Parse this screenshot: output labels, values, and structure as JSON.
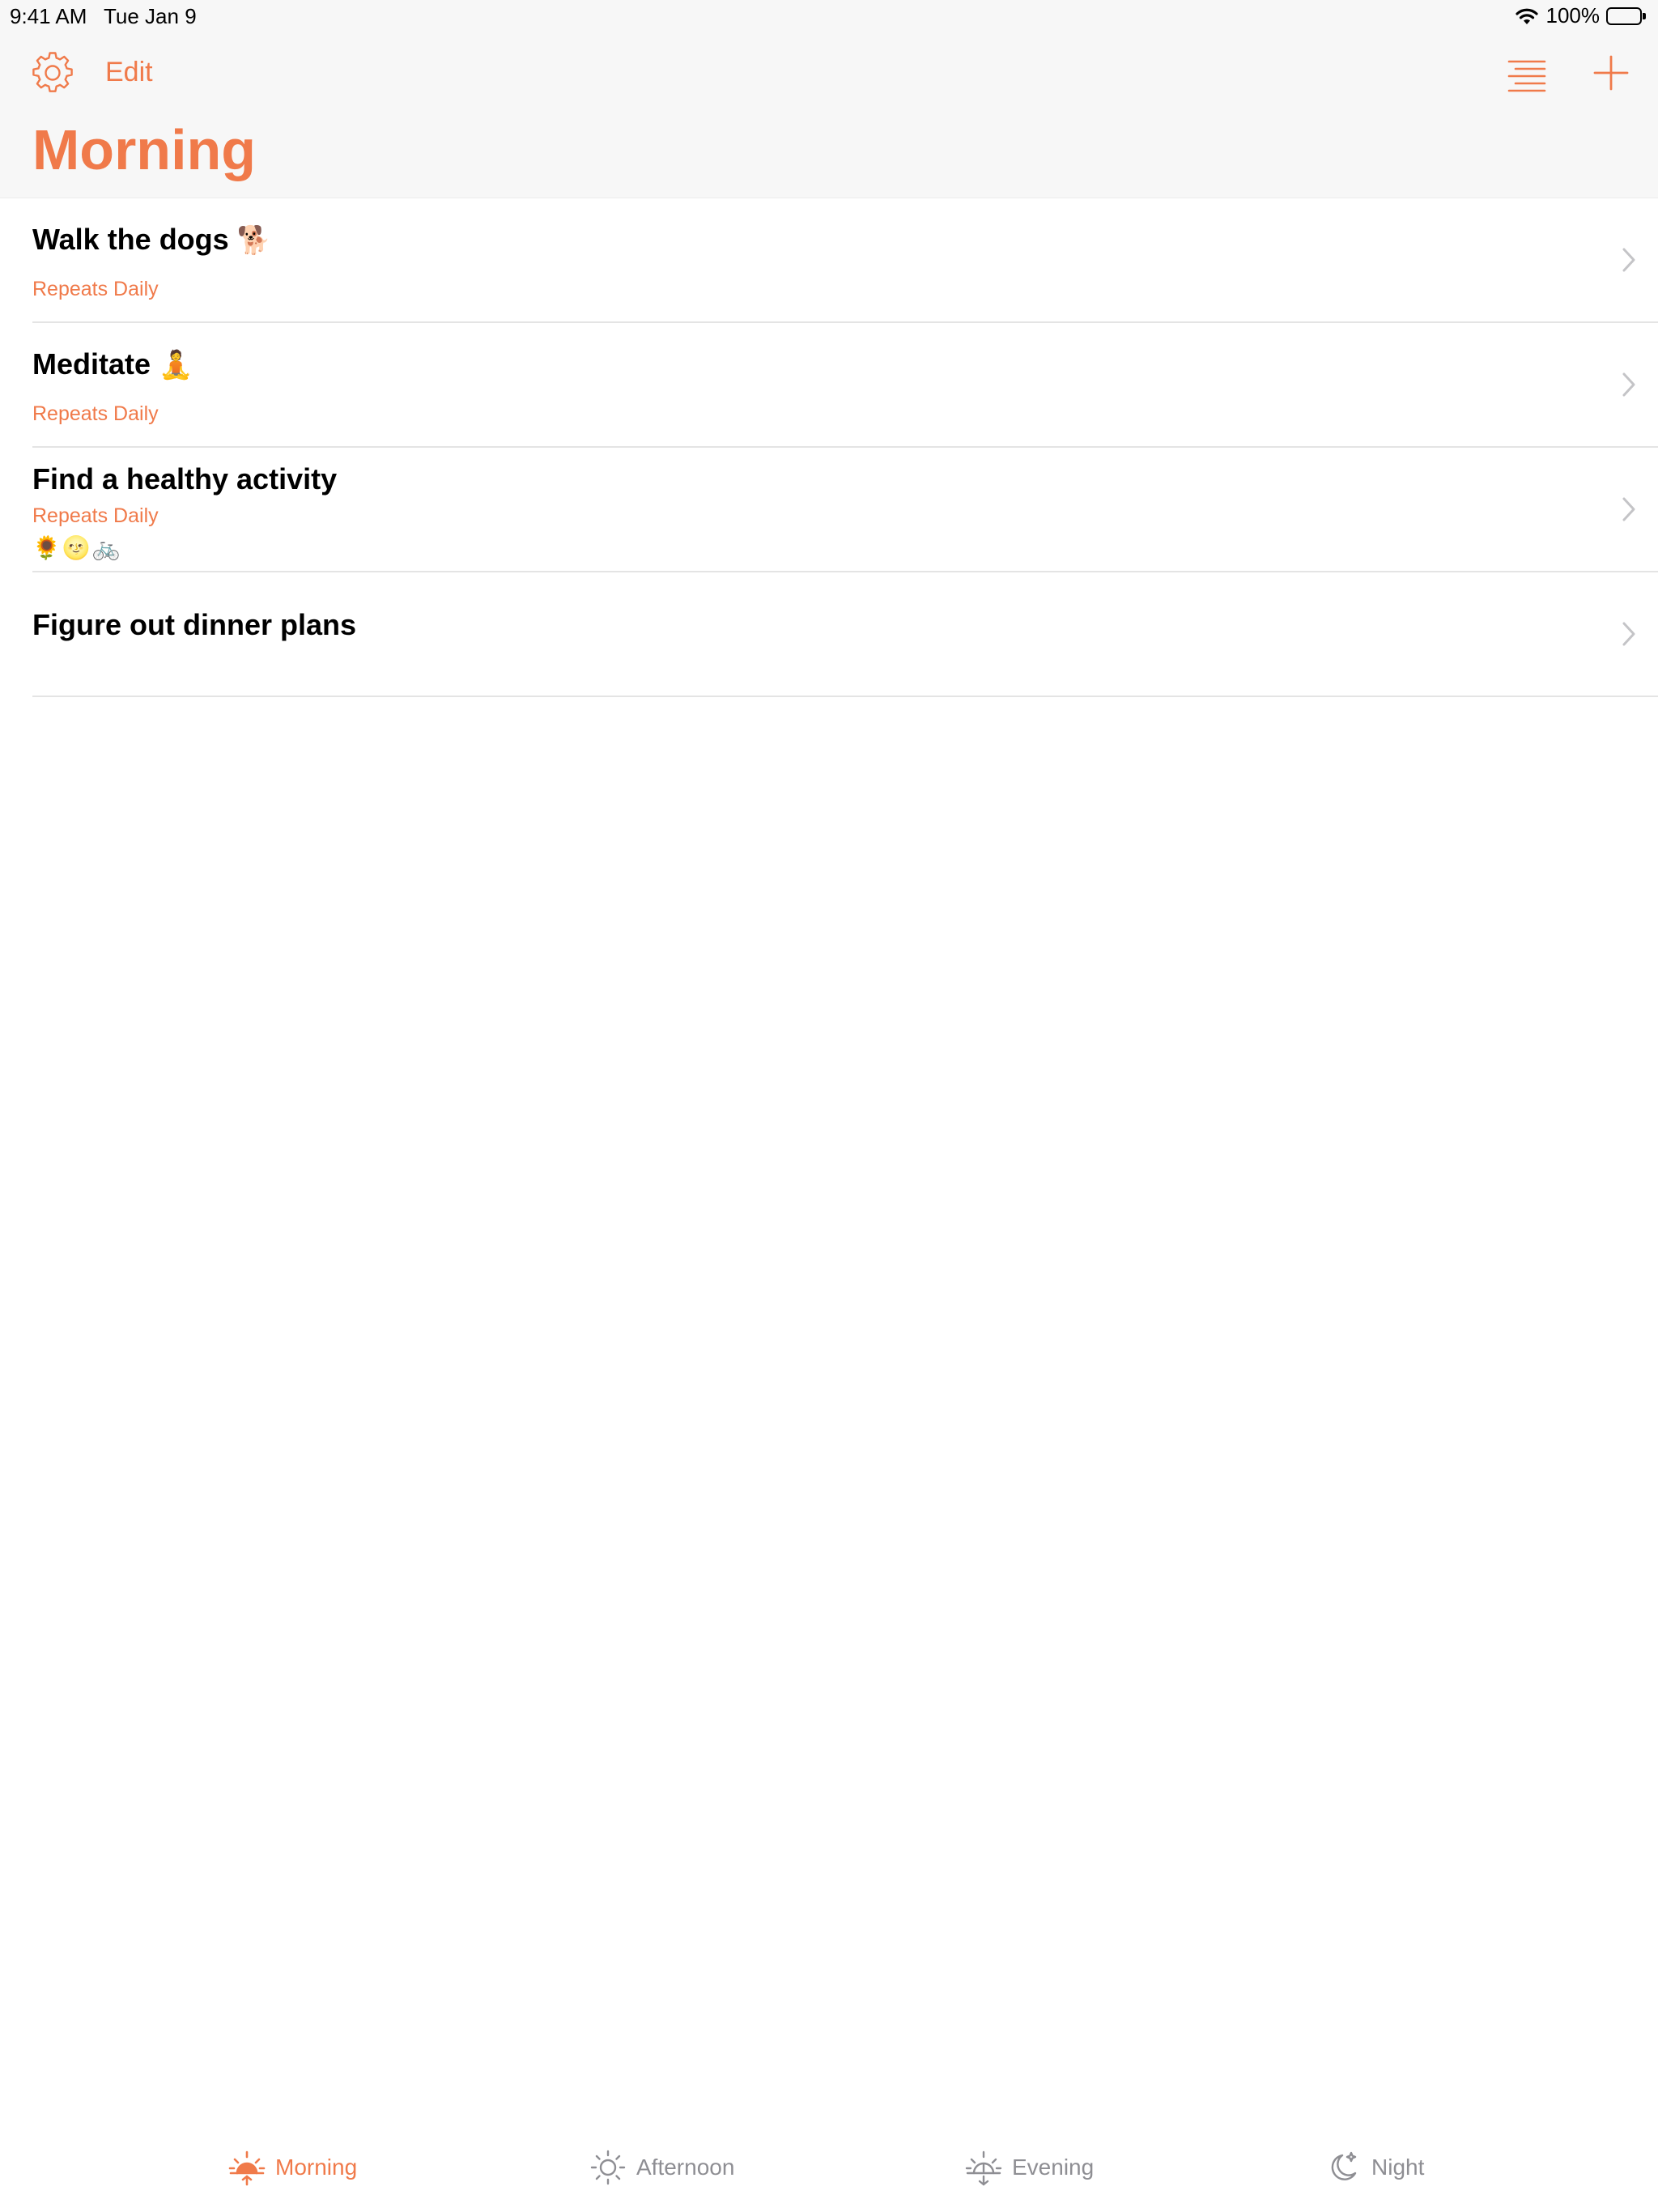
{
  "status_bar": {
    "time": "9:41 AM",
    "date": "Tue Jan 9",
    "battery": "100%",
    "battery_level": 1.0
  },
  "nav": {
    "settings_icon": "gear-icon",
    "edit_label": "Edit",
    "sort_icon": "sort-lines-icon",
    "add_icon": "plus-icon",
    "title": "Morning"
  },
  "tasks": [
    {
      "title": "Walk the dogs",
      "emoji": "🐕",
      "subtitle": "Repeats Daily",
      "notes": ""
    },
    {
      "title": "Meditate",
      "emoji": "🧘",
      "subtitle": "Repeats Daily",
      "notes": ""
    },
    {
      "title": "Find a healthy activity",
      "emoji": "",
      "subtitle": "Repeats Daily",
      "notes": "🌻🌝🚲"
    },
    {
      "title": "Figure out dinner plans",
      "emoji": "",
      "subtitle": "",
      "notes": ""
    }
  ],
  "tabs": [
    {
      "label": "Morning",
      "icon": "sunrise-icon",
      "active": true
    },
    {
      "label": "Afternoon",
      "icon": "sun-icon",
      "active": false
    },
    {
      "label": "Evening",
      "icon": "sunset-icon",
      "active": false
    },
    {
      "label": "Night",
      "icon": "moon-stars-icon",
      "active": false
    }
  ],
  "colors": {
    "accent": "#f07a4a",
    "inactive_tab": "#8e8e93",
    "separator": "#e4e4e4",
    "nav_background": "#f7f7f7"
  }
}
